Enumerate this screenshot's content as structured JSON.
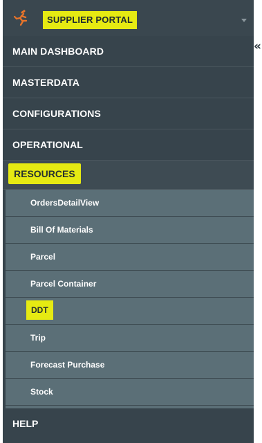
{
  "brand": {
    "title": "SUPPLIER PORTAL",
    "logo_icon": "runner-icon"
  },
  "menu": {
    "items": [
      {
        "label": "MAIN DASHBOARD"
      },
      {
        "label": "MASTERDATA"
      },
      {
        "label": "CONFIGURATIONS"
      },
      {
        "label": "OPERATIONAL"
      }
    ],
    "resources": {
      "label": "RESOURCES",
      "children": [
        {
          "label": "OrdersDetailView"
        },
        {
          "label": "Bill Of Materials"
        },
        {
          "label": "Parcel"
        },
        {
          "label": "Parcel Container"
        },
        {
          "label": "DDT"
        },
        {
          "label": "Trip"
        },
        {
          "label": "Forecast Purchase"
        },
        {
          "label": "Stock"
        }
      ]
    },
    "help_label": "HELP"
  },
  "colors": {
    "sidebar_bg": "#37444c",
    "submenu_bg": "#5b6f77",
    "highlight": "#e6ea12",
    "logo_accent": "#e8742a"
  },
  "icons": {
    "collapse": "double-chevron-left-icon"
  }
}
